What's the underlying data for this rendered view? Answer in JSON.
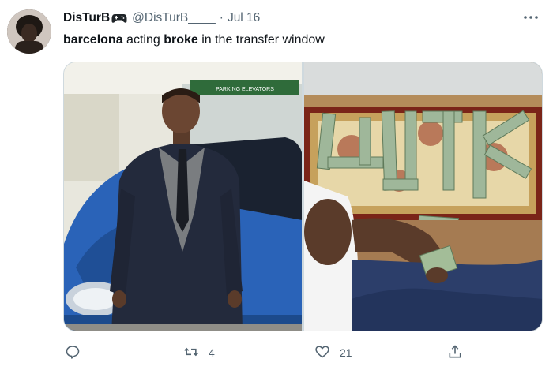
{
  "tweet": {
    "display_name": "DisTurB",
    "badge_icon": "game-controller-icon",
    "handle": "@DisTurB____",
    "separator": "·",
    "time": "Jul 16",
    "more_icon": "more-options-icon",
    "text_part1": "barcelona",
    "text_part2": " acting ",
    "text_part3": "broke",
    "text_part4": " in the transfer window"
  },
  "media": {
    "left_sign": "PARKING ELEVATORS"
  },
  "actions": {
    "reply": {
      "icon": "reply-icon",
      "count": ""
    },
    "retweet": {
      "icon": "retweet-icon",
      "count": "4"
    },
    "like": {
      "icon": "heart-icon",
      "count": "21"
    },
    "share": {
      "icon": "share-icon",
      "count": ""
    }
  },
  "colors": {
    "text_primary": "#0f1419",
    "text_secondary": "#536471",
    "border": "#cfd9de"
  }
}
